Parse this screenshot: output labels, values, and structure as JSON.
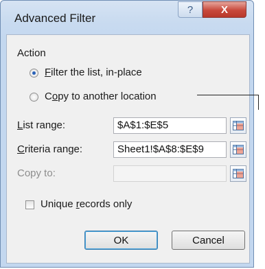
{
  "window": {
    "title": "Advanced Filter",
    "help_glyph": "?",
    "close_glyph": "X"
  },
  "action": {
    "group_label": "Action",
    "option1": {
      "pre": "",
      "key": "F",
      "post": "ilter the list, in-place",
      "selected": true
    },
    "option2": {
      "pre": "C",
      "key": "o",
      "post": "py to another location",
      "selected": false
    }
  },
  "list_range": {
    "key": "L",
    "label_rest": "ist range:",
    "value": "$A$1:$E$5"
  },
  "criteria_range": {
    "key": "C",
    "label_rest": "riteria range:",
    "value": "Sheet1!$A$8:$E$9"
  },
  "copy_to": {
    "label": "Copy to:",
    "value": "",
    "disabled": true
  },
  "unique": {
    "pre": "Unique ",
    "key": "r",
    "post": "ecords only",
    "checked": false
  },
  "buttons": {
    "ok": "OK",
    "cancel": "Cancel"
  },
  "icons": {
    "range_picker": "range-picker-icon"
  },
  "colors": {
    "accent": "#2a62b8",
    "close": "#c8493c",
    "frame": "#c3d7ef"
  }
}
